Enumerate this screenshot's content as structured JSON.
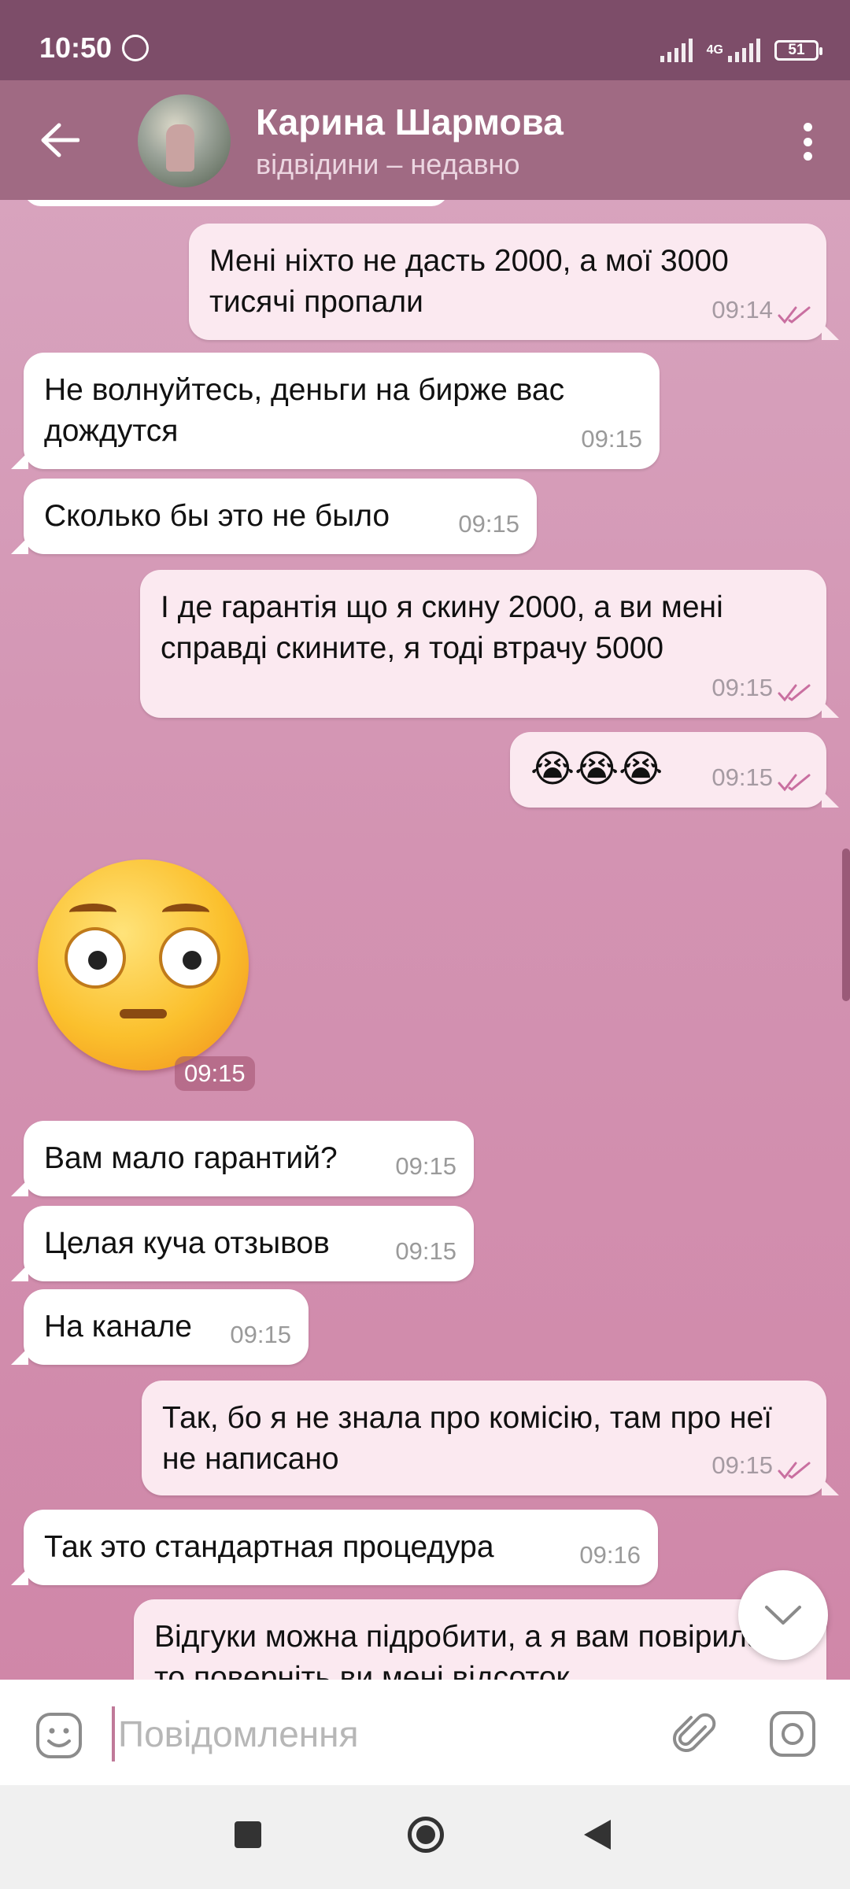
{
  "status_bar": {
    "time": "10:50",
    "network": "4G",
    "battery": "51"
  },
  "header": {
    "name": "Карина Шармова",
    "status": "відвідини – недавно"
  },
  "messages": [
    {
      "text": "Мені ніхто не дасть 2000, а мої 3000 тисячі пропали",
      "time": "09:14"
    },
    {
      "text": "Не волнуйтесь, деньги на бирже вас дождутся",
      "time": "09:15"
    },
    {
      "text": "Сколько бы это не было",
      "time": "09:15"
    },
    {
      "text": "І де гарантія що я скину 2000, а ви мені справді скините, я тоді втрачу 5000",
      "time": "09:15"
    },
    {
      "text": "😭😭😭",
      "time": "09:15"
    },
    {
      "text": "Вам мало гарантий?",
      "time": "09:15"
    },
    {
      "text": "Целая куча отзывов",
      "time": "09:15"
    },
    {
      "text": "На канале",
      "time": "09:15"
    },
    {
      "text": "Так, бо я не знала про комісію, там про неї не написано",
      "time": "09:15"
    },
    {
      "text": "Так это стандартная процедура",
      "time": "09:16"
    },
    {
      "text": "Відгуки можна підробити, а я вам повірила, то поверніть ви мені відсоток",
      "time": ""
    }
  ],
  "sticker": {
    "time": "09:15"
  },
  "input": {
    "placeholder": "Повідомлення"
  },
  "colors": {
    "header": "#a06a83",
    "statusbar": "#7d4d69",
    "outgoing_bubble": "#fbe9f0",
    "read_check": "#c96fa0"
  }
}
